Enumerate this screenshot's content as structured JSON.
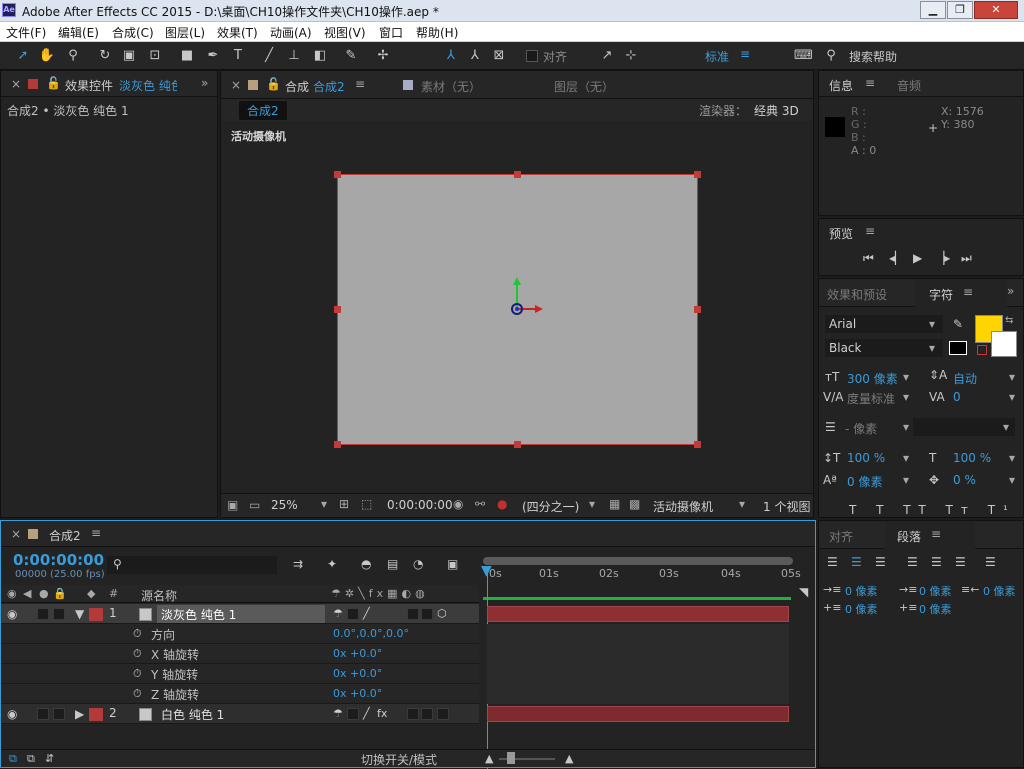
{
  "window": {
    "app_icon": "Ae",
    "title": "Adobe After Effects CC 2015 - D:\\桌面\\CH10操作文件夹\\CH10操作.aep *",
    "controls": [
      "▁",
      "❐",
      "✕"
    ]
  },
  "menu": [
    "文件(F)",
    "编辑(E)",
    "合成(C)",
    "图层(L)",
    "效果(T)",
    "动画(A)",
    "视图(V)",
    "窗口",
    "帮助(H)"
  ],
  "toolbar": {
    "snap_label": "对齐",
    "workspace": "标准",
    "search_placeholder": "搜索帮助"
  },
  "effects_panel": {
    "tab_label": "效果控件",
    "tab_layer": "淡灰色 纯色",
    "breadcrumb": "合成2 • 淡灰色 纯色 1"
  },
  "comp_panel": {
    "tab_label": "合成",
    "tab_comp": "合成2",
    "footage_tab": "素材（无）",
    "layer_tab": "图层（无）",
    "comp_chip": "合成2",
    "renderer_label": "渲染器：",
    "renderer_value": "经典 3D",
    "view_label": "活动摄像机",
    "zoom": "25%",
    "timecode": "0:00:00:00",
    "resolution": "(四分之一)",
    "camera": "活动摄像机",
    "views": "1 个视图"
  },
  "info_panel": {
    "tab_info": "信息",
    "tab_audio": "音频",
    "r_label": "R :",
    "g_label": "G :",
    "b_label": "B :",
    "a_label": "A : 0",
    "x_readout": "X: 1576",
    "y_readout": "Y: 380"
  },
  "preview_panel": {
    "tab_label": "预览"
  },
  "character_panel": {
    "tab_effects": "效果和预设",
    "tab_character": "字符",
    "font_family": "Arial",
    "font_style": "Black",
    "font_size": "300 像素",
    "leading": "自动",
    "kerning": "度量标准",
    "tracking": "0",
    "stroke": "- 像素",
    "v_scale": "100 %",
    "h_scale": "100 %",
    "baseline": "0 像素",
    "tsume": "0 %",
    "fill_color": "#ffd400"
  },
  "paragraph_panel": {
    "tab_align": "对齐",
    "tab_paragraph": "段落",
    "indent_left": "0 像素",
    "indent_first": "0 像素",
    "indent_right": "0 像素",
    "space_before": "0 像素",
    "space_after": "0 像素"
  },
  "timeline": {
    "tab_label": "合成2",
    "timecode": "0:00:00:00",
    "frames": "00000 (25.00 fps)",
    "col_name": "源名称",
    "ticks": [
      "0s",
      "01s",
      "02s",
      "03s",
      "04s",
      "05s"
    ],
    "layers": [
      {
        "num": "1",
        "name": "淡灰色 纯色 1",
        "color": "#b33a3a"
      },
      {
        "num": "2",
        "name": "白色 纯色 1",
        "color": "#b33a3a"
      }
    ],
    "props": [
      {
        "name": "方向",
        "value": "0.0°,0.0°,0.0°"
      },
      {
        "name": "X 轴旋转",
        "value": "0x +0.0°"
      },
      {
        "name": "Y 轴旋转",
        "value": "0x +0.0°"
      },
      {
        "name": "Z 轴旋转",
        "value": "0x +0.0°"
      }
    ],
    "toggle_label": "切换开关/模式"
  }
}
